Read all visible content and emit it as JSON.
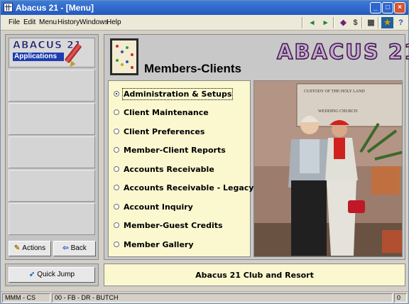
{
  "window": {
    "title": "Abacus 21 - [Menu]"
  },
  "menubar": {
    "items": [
      "File",
      "Edit",
      "Menu",
      "History",
      "Windows",
      "Help"
    ]
  },
  "toolbar": {
    "icons": [
      "arrow-left-icon",
      "arrow-right-icon",
      "book-icon",
      "dollar-icon",
      "calculator-icon",
      "runner-icon",
      "help-icon"
    ]
  },
  "sidebar": {
    "logo_line1": "ABACUS 21",
    "logo_line2": "Applications",
    "actions_label": "Actions",
    "back_label": "Back",
    "quick_jump_label": "Quick Jump"
  },
  "main": {
    "title": "Members-Clients",
    "brand": "ABACUS 21",
    "options": [
      {
        "label": "Administration & Setups",
        "selected": true
      },
      {
        "label": "Client Maintenance",
        "selected": false
      },
      {
        "label": "Client Preferences",
        "selected": false
      },
      {
        "label": "Member-Client Reports",
        "selected": false
      },
      {
        "label": "Accounts Receivable",
        "selected": false
      },
      {
        "label": "Accounts Receivable - Legacy",
        "selected": false
      },
      {
        "label": "Account Inquiry",
        "selected": false
      },
      {
        "label": "Member-Guest Credits",
        "selected": false
      },
      {
        "label": "Member Gallery",
        "selected": false
      }
    ],
    "photo_sign": [
      "CUSTODY OF THE HOLY LAND",
      "WEDDING CHURCH"
    ],
    "footer": "Abacus 21 Club and Resort"
  },
  "status": {
    "cell1": "MMM - CS",
    "cell2": "00 - FB - DR - BUTCH",
    "cell3": "0"
  }
}
